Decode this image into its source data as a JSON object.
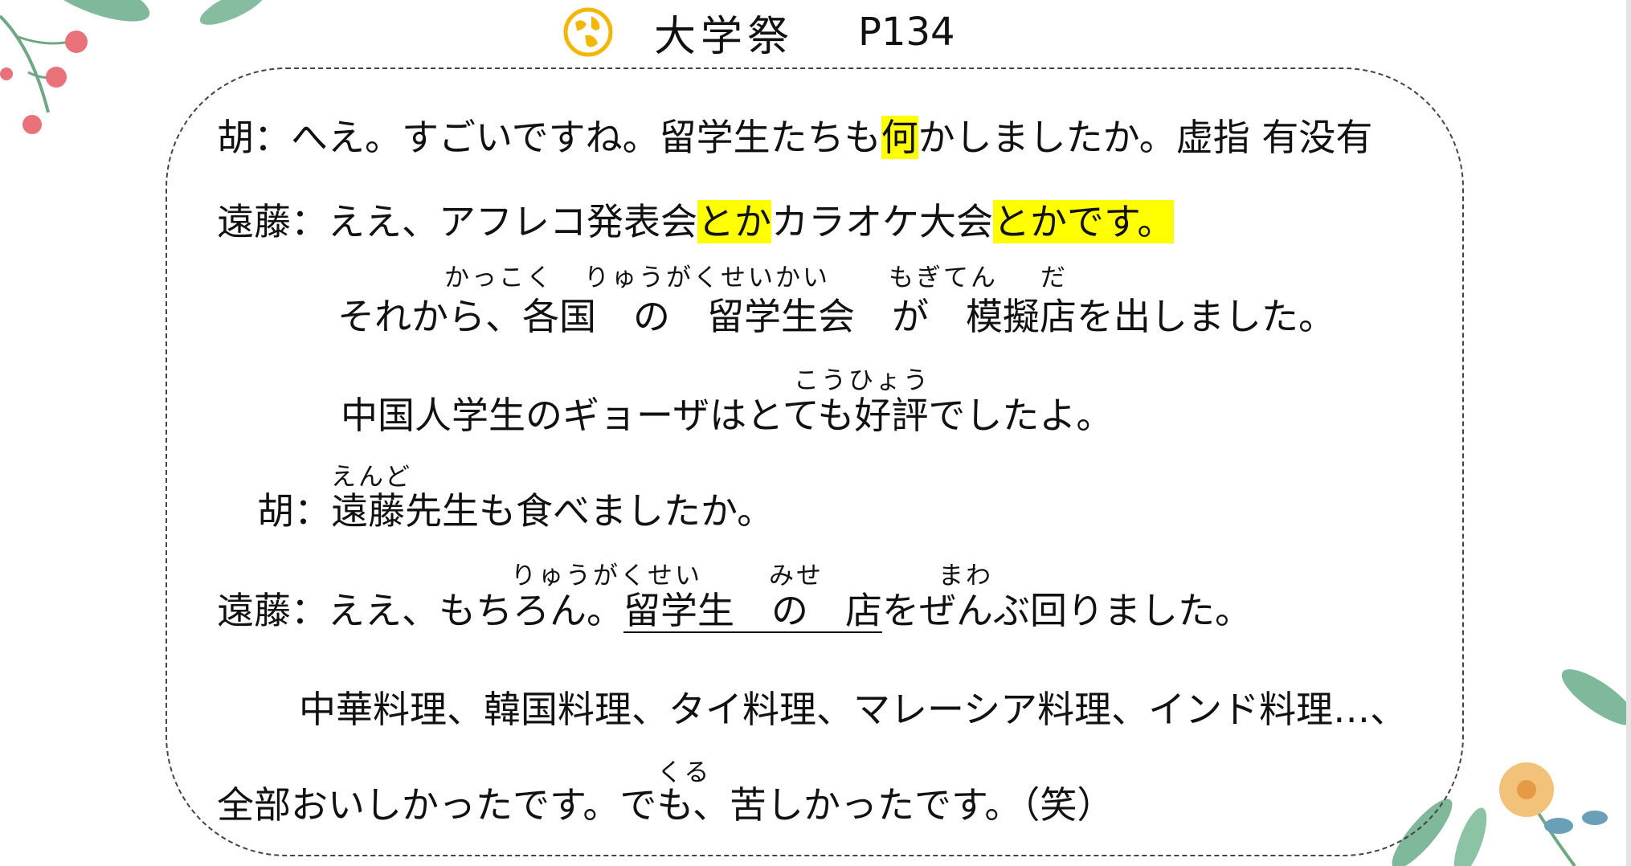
{
  "header": {
    "title": "大学祭",
    "page": "P134"
  },
  "dialogue": {
    "l1": {
      "speaker": "胡：",
      "a": "へえ。すごいですね。留学生たちも",
      "hl": "何",
      "b": "かしましたか。虚指 有没有"
    },
    "l2": {
      "speaker": "遠藤：",
      "a": "ええ、アフレコ発表会",
      "hl1": "とか",
      "b": "カラオケ大会",
      "hl2": "とかです。"
    },
    "l3": {
      "text": "それから、各国　の　留学生会　が　模擬店を出しました。",
      "furi_kakkoku": "かっこく",
      "furi_ryugakuseikai": "りゅうがくせいかい",
      "furi_mogiten": "もぎてん",
      "furi_da": "だ"
    },
    "l4": {
      "text": "中国人学生のギョーザはとても好評でしたよ。",
      "furi_kouhyou": "こうひょう"
    },
    "l5": {
      "speaker": "胡：",
      "text": "遠藤先生も食べましたか。",
      "furi_endo": "えんど"
    },
    "l6": {
      "speaker": "遠藤：",
      "a": "ええ、もちろん。",
      "ul": "留学生　の　店",
      "b": "をぜんぶ回りました。",
      "furi_ryugakusei": "りゅうがくせい",
      "furi_mise": "みせ",
      "furi_mawa": "まわ"
    },
    "l7": {
      "text": "中華料理、韓国料理、タイ料理、マレーシア料理、インド料理…、"
    },
    "l8": {
      "text": "全部おいしかったです。でも、苦しかったです。（笑）",
      "furi_kuru": "くる"
    }
  },
  "colors": {
    "highlight": "#ffff00",
    "logo": "#f2b705",
    "leaf_green": "#5f9e7a",
    "flower_pink": "#e8717a",
    "flower_orange": "#f0b060"
  }
}
